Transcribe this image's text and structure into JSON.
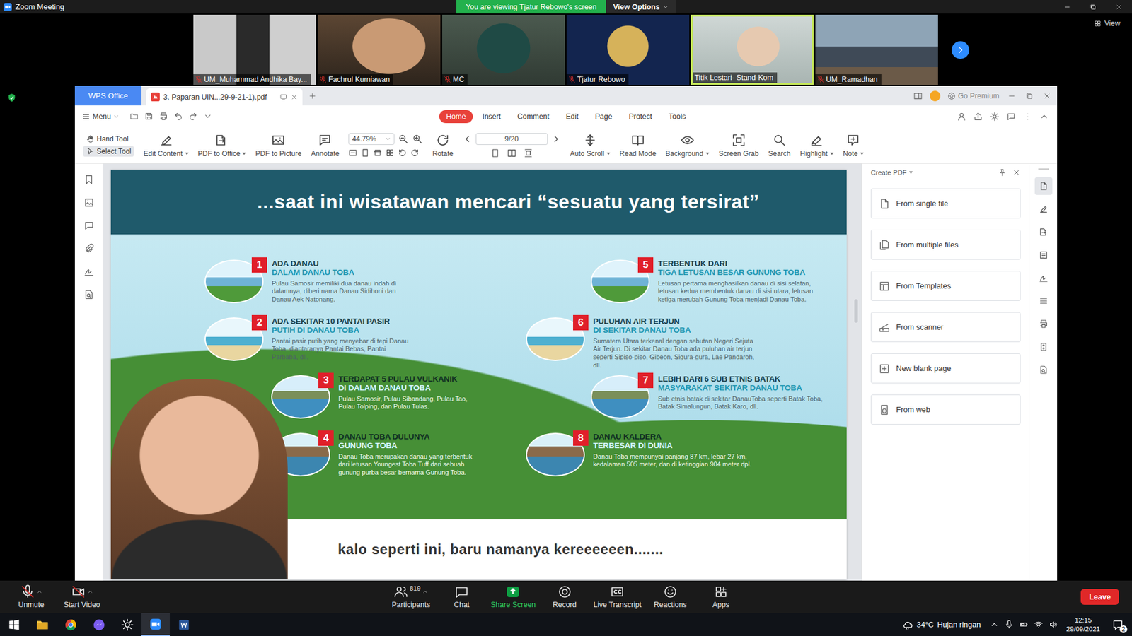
{
  "zoom": {
    "title": "Zoom Meeting",
    "share_banner": "You are viewing Tjatur Rebowo's screen",
    "view_options": "View Options",
    "view_button": "View",
    "participants": [
      {
        "name": "UM_Muhammad Andhika Bay...",
        "muted": true,
        "speaking": false
      },
      {
        "name": "Fachrul Kurniawan",
        "muted": true,
        "speaking": false
      },
      {
        "name": "MC",
        "muted": true,
        "speaking": false
      },
      {
        "name": "Tjatur Rebowo",
        "muted": true,
        "speaking": false
      },
      {
        "name": "Titik Lestari- Stand-Kom",
        "muted": false,
        "speaking": true
      },
      {
        "name": "UM_Ramadhan",
        "muted": true,
        "speaking": false
      }
    ],
    "controls_left": [
      {
        "label": "Unmute",
        "off": true
      },
      {
        "label": "Start Video",
        "off": true
      }
    ],
    "controls_center": [
      {
        "label": "Participants",
        "count": "819",
        "highlight": false
      },
      {
        "label": "Chat",
        "highlight": false
      },
      {
        "label": "Share Screen",
        "highlight": true
      },
      {
        "label": "Record",
        "highlight": false
      },
      {
        "label": "Live Transcript",
        "highlight": false
      },
      {
        "label": "Reactions",
        "highlight": false
      },
      {
        "label": "Apps",
        "highlight": false
      }
    ],
    "leave": "Leave"
  },
  "wps": {
    "app_tab": "WPS Office",
    "doc_tab": "3. Paparan UIN...29-9-21-1).pdf",
    "premium": "Go Premium",
    "menu": "Menu",
    "ribbon_tabs": [
      {
        "label": "Home",
        "selected": true
      },
      {
        "label": "Insert",
        "selected": false
      },
      {
        "label": "Comment",
        "selected": false
      },
      {
        "label": "Edit",
        "selected": false
      },
      {
        "label": "Page",
        "selected": false
      },
      {
        "label": "Protect",
        "selected": false
      },
      {
        "label": "Tools",
        "selected": false
      }
    ],
    "pointer_tools": [
      {
        "label": "Hand Tool",
        "selected": false
      },
      {
        "label": "Select Tool",
        "selected": true
      }
    ],
    "tools_left": [
      {
        "label": "Edit Content",
        "dropdown": true
      },
      {
        "label": "PDF to Office",
        "dropdown": true
      },
      {
        "label": "PDF to Picture",
        "dropdown": false
      },
      {
        "label": "Annotate",
        "dropdown": false
      }
    ],
    "zoom": "44.79%",
    "rotate": "Rotate",
    "page": "9/20",
    "tools_right": [
      {
        "label": "Auto Scroll",
        "dropdown": true
      },
      {
        "label": "Read Mode",
        "dropdown": false
      },
      {
        "label": "Background",
        "dropdown": true
      },
      {
        "label": "Screen Grab",
        "dropdown": false
      },
      {
        "label": "Search",
        "dropdown": false
      },
      {
        "label": "Highlight",
        "dropdown": true
      },
      {
        "label": "Note",
        "dropdown": true
      }
    ],
    "right_rail": [
      {
        "selected": true
      },
      {
        "selected": false
      },
      {
        "selected": false
      },
      {
        "selected": false
      },
      {
        "selected": false
      },
      {
        "selected": false
      },
      {
        "selected": false
      },
      {
        "selected": false
      },
      {
        "selected": false
      }
    ],
    "panel": {
      "title": "Create PDF",
      "options": [
        "From single file",
        "From multiple files",
        "From Templates",
        "From scanner",
        "New blank page",
        "From web"
      ]
    }
  },
  "slide": {
    "title": "...saat ini wisatawan mencari “sesuatu yang tersirat”",
    "facts": [
      {
        "number": "1",
        "title": "ADA DANAU",
        "subtitle": "DALAM DANAU TOBA",
        "text": "Pulau Samosir memiliki dua danau indah di dalamnya, diberi nama Danau Sidihoni dan Danau Aek Natonang."
      },
      {
        "number": "2",
        "title": "ADA SEKITAR 10 PANTAI PASIR",
        "subtitle": "PUTIH DI DANAU TOBA",
        "text": "Pantai pasir putih yang menyebar di tepi Danau Toba, diantaranya Pantai Bebas, Pantai Parbaba, dll."
      },
      {
        "number": "3",
        "title": "TERDAPAT 5 PULAU VULKANIK",
        "subtitle": "DI DALAM DANAU TOBA",
        "text": "Pulau Samosir, Pulau Sibandang, Pulau Tao, Pulau Tolping, dan Pulau Tulas."
      },
      {
        "number": "4",
        "title": "DANAU TOBA DULUNYA",
        "subtitle": "GUNUNG TOBA",
        "text": "Danau Toba merupakan danau yang terbentuk dari letusan Youngest Toba Tuff dari sebuah gunung purba besar bernama Gunung Toba."
      },
      {
        "number": "5",
        "title": "TERBENTUK DARI",
        "subtitle": "TIGA LETUSAN BESAR GUNUNG TOBA",
        "text": "Letusan pertama menghasilkan danau di sisi selatan, letusan kedua membentuk danau di sisi utara, letusan ketiga merubah Gunung Toba menjadi Danau Toba."
      },
      {
        "number": "6",
        "title": "PULUHAN AIR TERJUN",
        "subtitle": "DI SEKITAR DANAU TOBA",
        "text": "Sumatera Utara terkenal dengan sebutan Negeri Sejuta Air Terjun. Di sekitar Danau Toba ada puluhan air terjun seperti Sipiso-piso, Gibeon, Sigura-gura, Lae Pandaroh, dll."
      },
      {
        "number": "7",
        "title": "LEBIH DARI 6 SUB ETNIS BATAK",
        "subtitle": "MASYARAKAT SEKITAR DANAU TOBA",
        "text": "Sub etnis batak di sekitar DanauToba seperti Batak Toba, Batak Simalungun, Batak Karo, dll."
      },
      {
        "number": "8",
        "title": "DANAU KALDERA",
        "subtitle": "TERBESAR DI DUNIA",
        "text": "Danau Toba mempunyai panjang 87 km, lebar 27 km, kedalaman 505 meter, dan di ketinggian 904 meter dpl."
      }
    ],
    "caption": "kalo seperti ini, baru namanya kereeeeeen......."
  },
  "taskbar": {
    "apps": [
      {
        "active": false
      },
      {
        "active": false
      },
      {
        "active": false
      },
      {
        "active": false
      },
      {
        "active": true
      },
      {
        "active": false
      }
    ],
    "weather_temp": "34°C",
    "weather_text": "Hujan ringan",
    "time": "12:15",
    "date": "29/09/2021",
    "notifications": "2"
  }
}
